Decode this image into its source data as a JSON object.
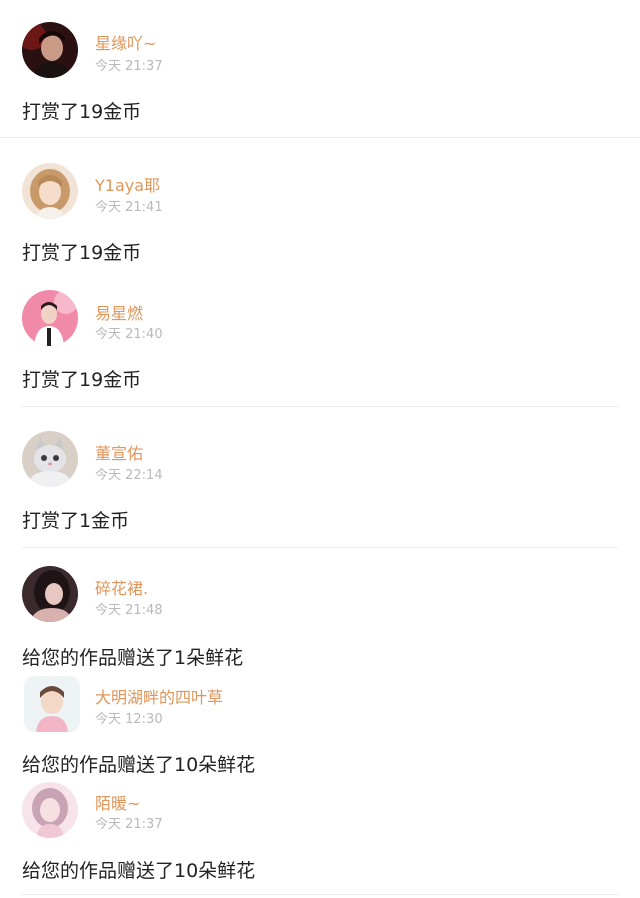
{
  "colors": {
    "username": "#e0965a",
    "timestamp": "#b9b9b9",
    "message": "#222222",
    "divider": "#eeeeee",
    "background": "#ffffff"
  },
  "feed": [
    {
      "name": "星缘吖~",
      "time": "今天 21:37",
      "message": "打赏了19金币",
      "avatar": "avatar-man-dark-red"
    },
    {
      "name": "Y1aya耶",
      "time": "今天 21:41",
      "message": "打赏了19金币",
      "avatar": "avatar-girl-blonde"
    },
    {
      "name": "易星燃",
      "time": "今天 21:40",
      "message": "打赏了19金币",
      "avatar": "avatar-boy-pink"
    },
    {
      "name": "董宣佑",
      "time": "今天 22:14",
      "message": "打赏了1金币",
      "avatar": "avatar-cat"
    },
    {
      "name": "碎花裙.",
      "time": "今天 21:48",
      "message": "给您的作品赠送了1朵鲜花",
      "avatar": "avatar-girl-dark"
    },
    {
      "name": "大明湖畔的四叶草",
      "time": "今天 12:30",
      "message": "给您的作品赠送了10朵鲜花",
      "avatar": "avatar-boy-cartoon"
    },
    {
      "name": "陌暖~",
      "time": "今天 21:37",
      "message": "给您的作品赠送了10朵鲜花",
      "avatar": "avatar-girl-pink"
    }
  ]
}
